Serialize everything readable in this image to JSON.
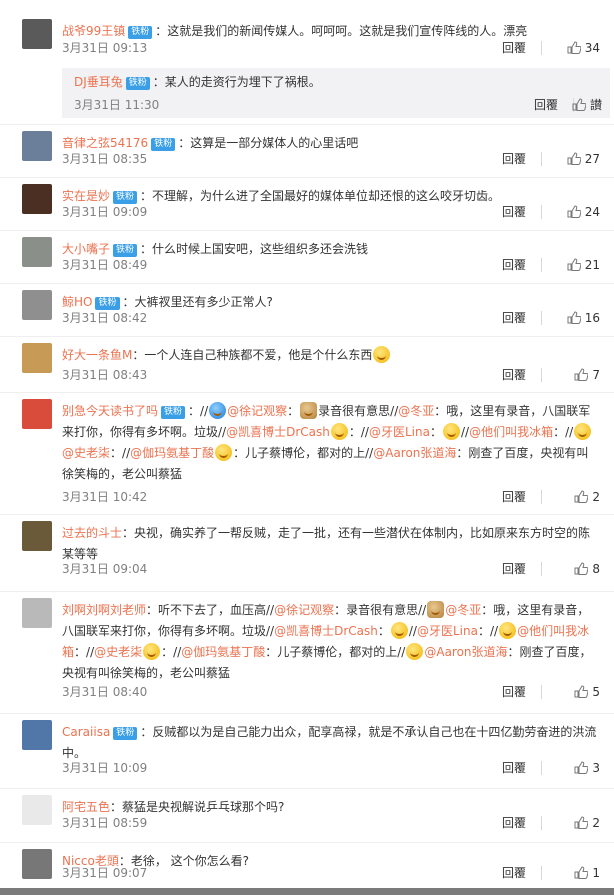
{
  "comments": [
    {
      "user": "战爷99王镇",
      "badge": "铁粉",
      "text": "：这就是我们的新闻传媒人。呵呵呵。这就是我们宣传阵线的人。漂亮",
      "time": "3月31日 09:13",
      "reply": "回覆",
      "likes": "34"
    },
    {
      "user": "DJ垂耳兔",
      "badge": "铁粉",
      "text": "：某人的走资行为埋下了祸根。",
      "time": "3月31日 11:30",
      "reply": "回覆",
      "likes": "讃"
    },
    {
      "user": "音律之弦54176",
      "badge": "铁粉",
      "text": "：这算是一部分媒体人的心里话吧",
      "time": "3月31日 08:35",
      "reply": "回覆",
      "likes": "27"
    },
    {
      "user": "实在是妙",
      "badge": "铁粉",
      "text": "：不理解，为什么进了全国最好的媒体单位却还恨的这么咬牙切齿。",
      "time": "3月31日 09:09",
      "reply": "回覆",
      "likes": "24"
    },
    {
      "user": "大小嘴子",
      "badge": "铁粉",
      "text": "：什么时候上国安吧，这些组织多还会洗钱",
      "time": "3月31日 08:49",
      "reply": "回覆",
      "likes": "21"
    },
    {
      "user": "鲸HO",
      "badge": "铁粉",
      "text": "：大裤衩里还有多少正常人?",
      "time": "3月31日 08:42",
      "reply": "回覆",
      "likes": "16"
    },
    {
      "user": "好大一条鱼M",
      "text": "：一个人连自己种族都不爱，他是个什么东西",
      "time": "3月31日 08:43",
      "reply": "回覆",
      "likes": "7"
    },
    {
      "user": "别急今天读书了吗",
      "badge": "铁粉",
      "parts": [
        "：",
        "//",
        "@徐记观察",
        "：",
        "录音很有意思//",
        "@冬亚",
        "：哦，这里有录音，八国联军来打你，你得有多坏啊。垃圾//",
        "@凯喜博士DrCash",
        "：",
        "//",
        "@牙医Lina",
        "：",
        "//",
        "@他们叫我冰箱",
        "：",
        "//",
        "@史老柒",
        "：",
        "//",
        "@伽玛氨基丁酸",
        "：儿子蔡博伦，都对的上//",
        "@Aaron张道海",
        "：刚查了百度，央视有叫徐笑梅的，老公叫蔡猛"
      ],
      "time": "3月31日 10:42",
      "reply": "回覆",
      "likes": "2"
    },
    {
      "user": "过去的斗士",
      "text": "：央视，确实养了一帮反贼，走了一批，还有一些潜伏在体制内，比如原来东方时空的陈某等等",
      "time": "3月31日 09:04",
      "reply": "回覆",
      "likes": "8"
    },
    {
      "user": "刘啊刘啊刘老师",
      "parts": [
        "：听不下去了，血压高//",
        "@徐记观察",
        "：",
        "录音很有意思//",
        "@冬亚",
        "：哦，这里有录音，八国联军来打你，你得有多坏啊。垃圾//",
        "@凯喜博士DrCash",
        "：",
        "//",
        "@牙医Lina",
        "：",
        "//",
        "@他们叫我冰箱",
        "：",
        "//",
        "@史老柒",
        "：",
        "//",
        "@伽玛氨基丁酸",
        "：儿子蔡博伦，都对的上//",
        "@Aaron张道海",
        "：刚查了百度，央视有叫徐笑梅的，老公叫蔡猛"
      ],
      "time": "3月31日 08:40",
      "reply": "回覆",
      "likes": "5"
    },
    {
      "user": "Caraiisa",
      "badge": "铁粉",
      "text": "：反贼都以为是自己能力出众，配享高禄，就是不承认自己也在十四亿勤劳奋进的洪流中。",
      "time": "3月31日 10:09",
      "reply": "回覆",
      "likes": "3"
    },
    {
      "user": "阿宅五色",
      "text": "：蔡猛是央视解说乒乓球那个吗?",
      "time": "3月31日 08:59",
      "reply": "回覆",
      "likes": "2"
    },
    {
      "user": "Nicco老頭",
      "text": "：老徐， 这个你怎么看?",
      "time": "3月31日 09:07",
      "reply": "回覆",
      "likes": "1"
    }
  ],
  "colors": {
    "username": "#eb7350",
    "fan_badge": "#3a9fe7",
    "subreply_bg": "#f2f2f5"
  }
}
